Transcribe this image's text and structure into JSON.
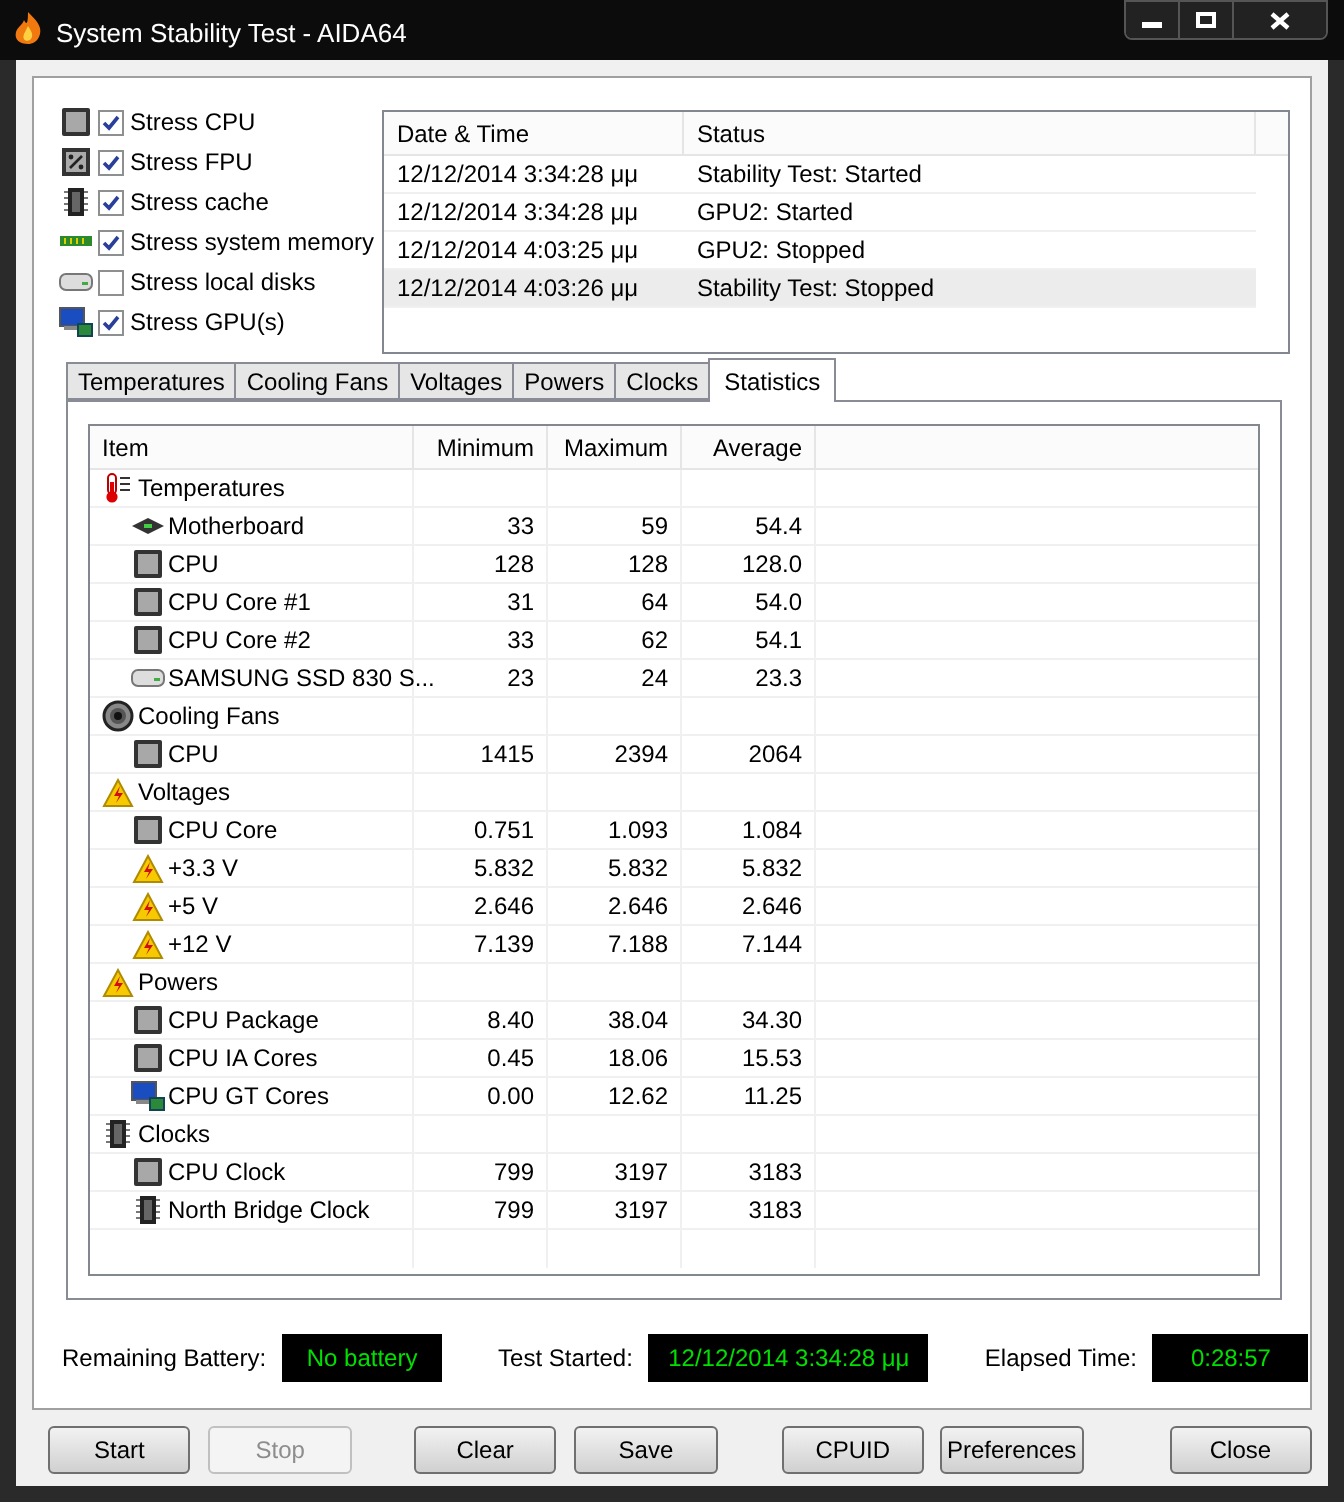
{
  "window": {
    "title": "System Stability Test - AIDA64"
  },
  "stress_options": [
    {
      "label": "Stress CPU",
      "checked": true
    },
    {
      "label": "Stress FPU",
      "checked": true
    },
    {
      "label": "Stress cache",
      "checked": true
    },
    {
      "label": "Stress system memory",
      "checked": true
    },
    {
      "label": "Stress local disks",
      "checked": false
    },
    {
      "label": "Stress GPU(s)",
      "checked": true
    }
  ],
  "log": {
    "columns": [
      "Date & Time",
      "Status"
    ],
    "rows": [
      {
        "time": "12/12/2014 3:34:28 μμ",
        "status": "Stability Test: Started",
        "selected": false
      },
      {
        "time": "12/12/2014 3:34:28 μμ",
        "status": "GPU2: Started",
        "selected": false
      },
      {
        "time": "12/12/2014 4:03:25 μμ",
        "status": "GPU2: Stopped",
        "selected": false
      },
      {
        "time": "12/12/2014 4:03:26 μμ",
        "status": "Stability Test: Stopped",
        "selected": true
      }
    ]
  },
  "tabs": [
    {
      "label": "Temperatures",
      "selected": false
    },
    {
      "label": "Cooling Fans",
      "selected": false
    },
    {
      "label": "Voltages",
      "selected": false
    },
    {
      "label": "Powers",
      "selected": false
    },
    {
      "label": "Clocks",
      "selected": false
    },
    {
      "label": "Statistics",
      "selected": true
    }
  ],
  "statistics": {
    "columns": [
      "Item",
      "Minimum",
      "Maximum",
      "Average"
    ],
    "rows": [
      {
        "kind": "group",
        "item": "Temperatures"
      },
      {
        "kind": "item",
        "item": "Motherboard",
        "minimum": "33",
        "maximum": "59",
        "average": "54.4"
      },
      {
        "kind": "item",
        "item": "CPU",
        "minimum": "128",
        "maximum": "128",
        "average": "128.0"
      },
      {
        "kind": "item",
        "item": "CPU Core #1",
        "minimum": "31",
        "maximum": "64",
        "average": "54.0"
      },
      {
        "kind": "item",
        "item": "CPU Core #2",
        "minimum": "33",
        "maximum": "62",
        "average": "54.1"
      },
      {
        "kind": "item",
        "item": "SAMSUNG SSD 830 S...",
        "minimum": "23",
        "maximum": "24",
        "average": "23.3"
      },
      {
        "kind": "group",
        "item": "Cooling Fans"
      },
      {
        "kind": "item",
        "item": "CPU",
        "minimum": "1415",
        "maximum": "2394",
        "average": "2064"
      },
      {
        "kind": "group",
        "item": "Voltages"
      },
      {
        "kind": "item",
        "item": "CPU Core",
        "minimum": "0.751",
        "maximum": "1.093",
        "average": "1.084"
      },
      {
        "kind": "item",
        "item": "+3.3 V",
        "minimum": "5.832",
        "maximum": "5.832",
        "average": "5.832"
      },
      {
        "kind": "item",
        "item": "+5 V",
        "minimum": "2.646",
        "maximum": "2.646",
        "average": "2.646"
      },
      {
        "kind": "item",
        "item": "+12 V",
        "minimum": "7.139",
        "maximum": "7.188",
        "average": "7.144"
      },
      {
        "kind": "group",
        "item": "Powers"
      },
      {
        "kind": "item",
        "item": "CPU Package",
        "minimum": "8.40",
        "maximum": "38.04",
        "average": "34.30"
      },
      {
        "kind": "item",
        "item": "CPU IA Cores",
        "minimum": "0.45",
        "maximum": "18.06",
        "average": "15.53"
      },
      {
        "kind": "item",
        "item": "CPU GT Cores",
        "minimum": "0.00",
        "maximum": "12.62",
        "average": "11.25"
      },
      {
        "kind": "group",
        "item": "Clocks"
      },
      {
        "kind": "item",
        "item": "CPU Clock",
        "minimum": "799",
        "maximum": "3197",
        "average": "3183"
      },
      {
        "kind": "item",
        "item": "North Bridge Clock",
        "minimum": "799",
        "maximum": "3197",
        "average": "3183"
      }
    ]
  },
  "status": [
    {
      "label": "Remaining Battery:",
      "value": "No battery"
    },
    {
      "label": "Test Started:",
      "value": "12/12/2014 3:34:28 μμ"
    },
    {
      "label": "Elapsed Time:",
      "value": "0:28:57"
    }
  ],
  "buttons": [
    {
      "label": "Start",
      "disabled": false
    },
    {
      "label": "Stop",
      "disabled": true
    },
    {
      "label": "Clear",
      "disabled": false
    },
    {
      "label": "Save",
      "disabled": false
    },
    {
      "label": "CPUID",
      "disabled": false
    },
    {
      "label": "Preferences",
      "disabled": false
    },
    {
      "label": "Close",
      "disabled": false
    }
  ]
}
